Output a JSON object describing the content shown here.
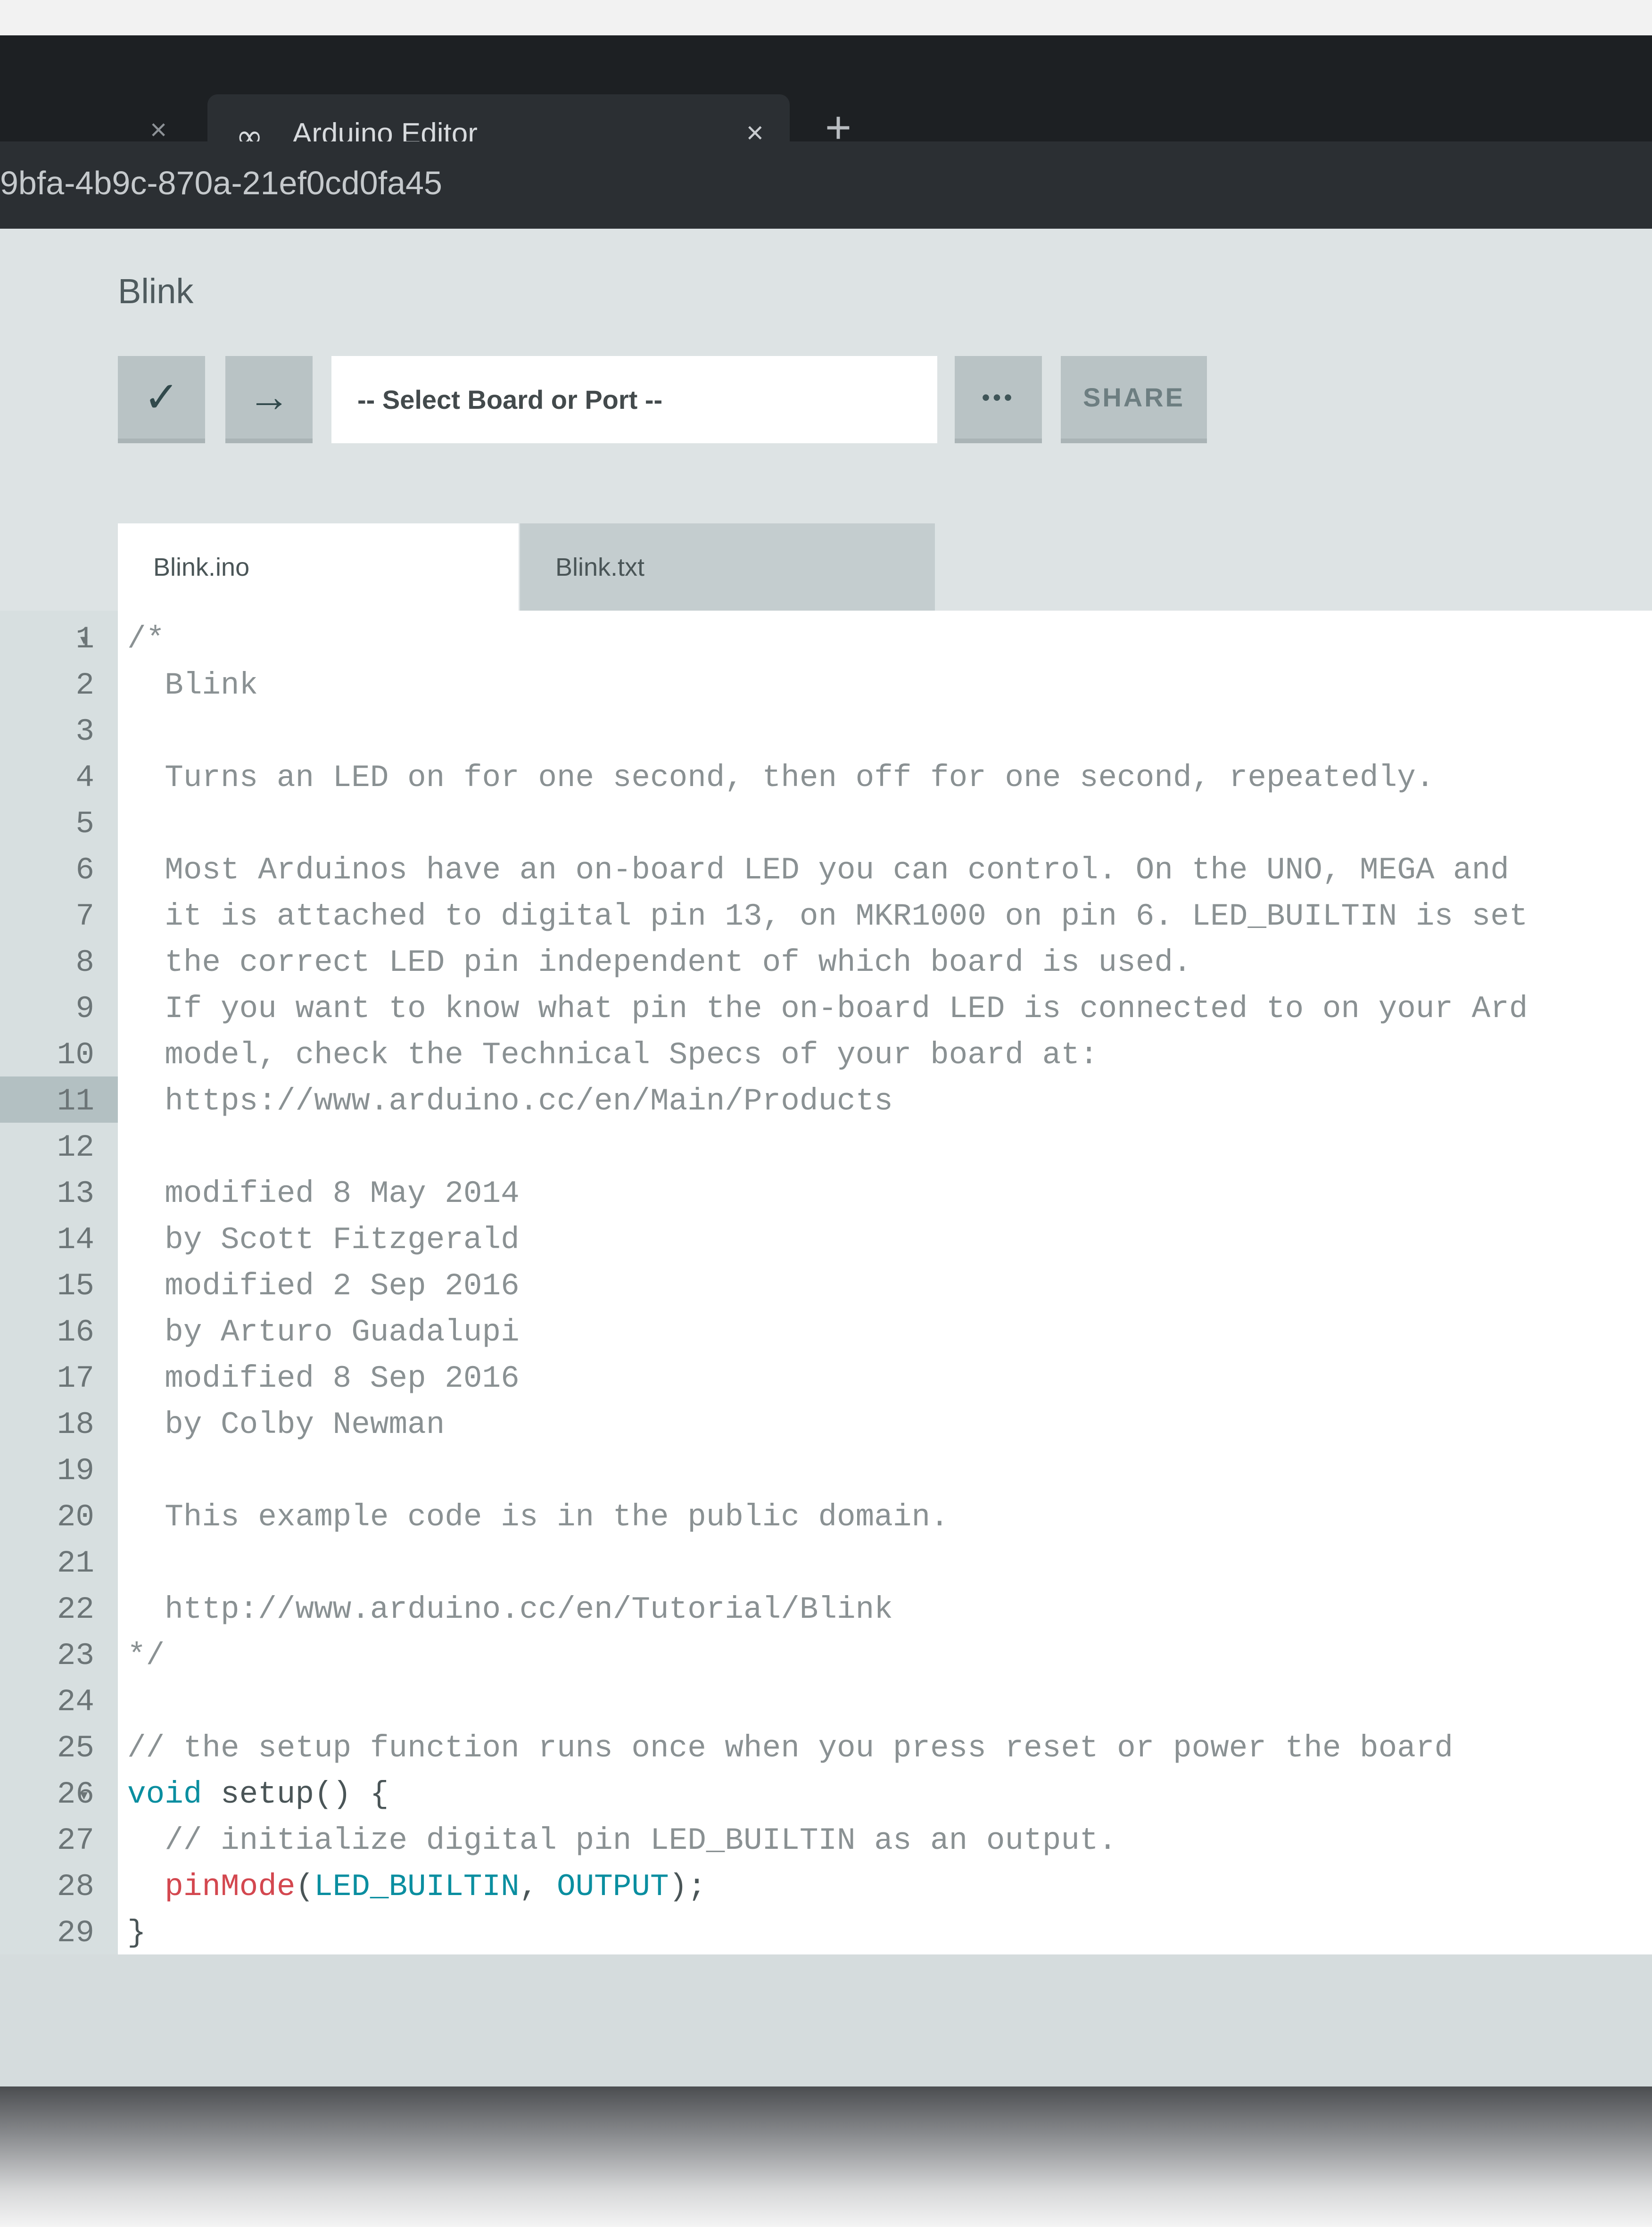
{
  "browser": {
    "prev_tab_close": "×",
    "tab_logo": "∞",
    "tab_title": "Arduino Editor",
    "tab_close": "×",
    "new_tab": "+",
    "url": "9bfa-4b9c-870a-21ef0cd0fa45"
  },
  "app": {
    "sketch_name": "Blink",
    "toolbar": {
      "verify_icon": "✓",
      "upload_icon": "→",
      "board_select_placeholder": "-- Select Board or Port --",
      "more_label": "•••",
      "share_label": "SHARE"
    },
    "file_tabs": [
      {
        "label": "Blink.ino",
        "active": true
      },
      {
        "label": "Blink.txt",
        "active": false
      }
    ]
  },
  "editor": {
    "highlighted_line": 11,
    "line_numbers": [
      "1",
      "2",
      "3",
      "4",
      "5",
      "6",
      "7",
      "8",
      "9",
      "10",
      "11",
      "12",
      "13",
      "14",
      "15",
      "16",
      "17",
      "18",
      "19",
      "20",
      "21",
      "22",
      "23",
      "24",
      "25",
      "26",
      "27",
      "28",
      "29"
    ],
    "lines": [
      "/*",
      "  Blink",
      "",
      "  Turns an LED on for one second, then off for one second, repeatedly.",
      "",
      "  Most Arduinos have an on-board LED you can control. On the UNO, MEGA and",
      "  it is attached to digital pin 13, on MKR1000 on pin 6. LED_BUILTIN is set",
      "  the correct LED pin independent of which board is used.",
      "  If you want to know what pin the on-board LED is connected to on your Ard",
      "  model, check the Technical Specs of your board at:",
      "  https://www.arduino.cc/en/Main/Products",
      "",
      "  modified 8 May 2014",
      "  by Scott Fitzgerald",
      "  modified 2 Sep 2016",
      "  by Arturo Guadalupi",
      "  modified 8 Sep 2016",
      "  by Colby Newman",
      "",
      "  This example code is in the public domain.",
      "",
      "  http://www.arduino.cc/en/Tutorial/Blink",
      "*/",
      "",
      "// the setup function runs once when you press reset or power the board",
      "",
      "  // initialize digital pin LED_BUILTIN as an output.",
      "",
      "}"
    ],
    "line26": {
      "keyword": "void",
      "rest": " setup() {"
    },
    "line28": {
      "indent": "  ",
      "fn": "pinMode",
      "open": "(",
      "arg1": "LED_BUILTIN",
      "sep": ", ",
      "arg2": "OUTPUT",
      "close": ");"
    },
    "colors": {
      "keyword": "#0a8ea0",
      "function": "#d3474f",
      "comment": "#8a9193"
    }
  }
}
